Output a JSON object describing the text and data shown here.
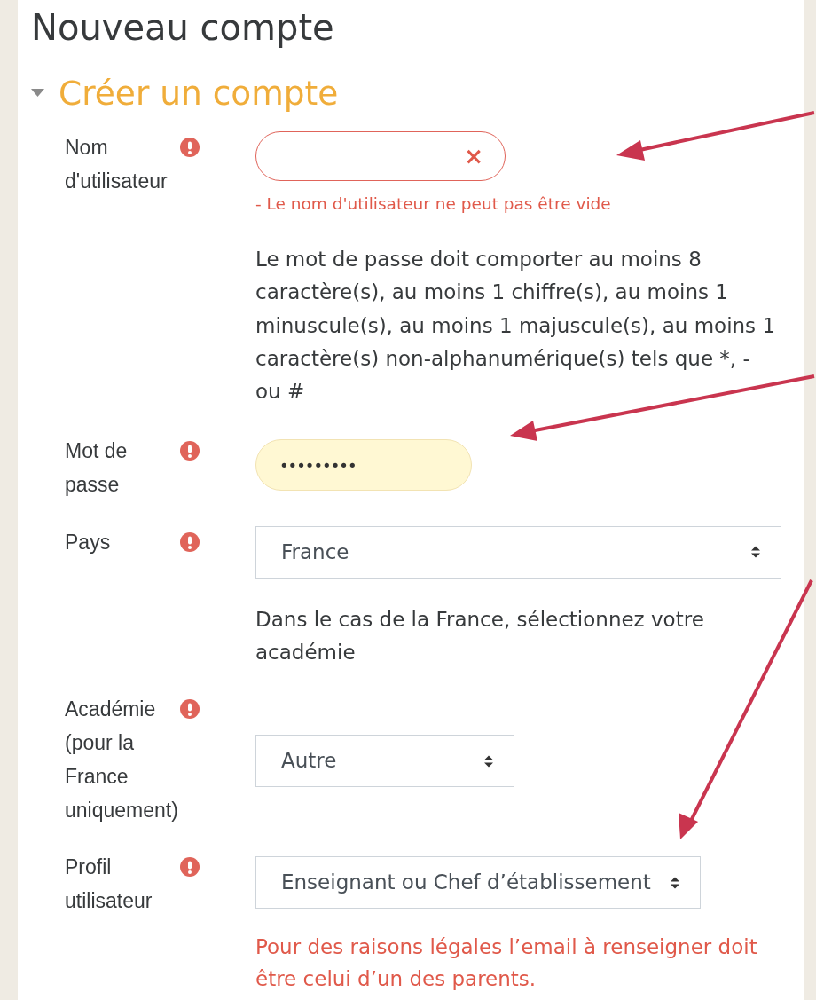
{
  "page": {
    "title": "Nouveau compte"
  },
  "section": {
    "title": "Créer un compte",
    "expanded": true
  },
  "rows": [
    {
      "kind": "text",
      "label": "Nom d'utilisateur",
      "required": true,
      "invalid": true,
      "clear_icon": "×",
      "error": "- Le nom d'utilisateur ne peut pas être vide"
    },
    {
      "kind": "note",
      "text": "Le mot de passe doit comporter au moins 8 caractère(s), au moins 1 chiffre(s), au moins 1 minuscule(s), au moins 1 majuscule(s), au moins 1 caractère(s) non-alphanumérique(s) tels que *, - ou #"
    },
    {
      "kind": "password",
      "label": "Mot de passe",
      "required": true,
      "autofilled": true,
      "value": "•••••••••"
    },
    {
      "kind": "select",
      "label": "Pays",
      "required": true,
      "value": "France"
    },
    {
      "kind": "note",
      "text": "Dans le cas de la France, sélectionnez votre académie"
    },
    {
      "kind": "select",
      "label": "Académie (pour la France uniquement)",
      "required": true,
      "value": "Autre"
    },
    {
      "kind": "select",
      "label": "Profil utilisateur",
      "required": true,
      "value": "Enseignant ou Chef d’établissement"
    },
    {
      "kind": "warning",
      "text": "Pour des raisons légales l’email à renseigner doit être celui d’un des parents."
    }
  ]
}
